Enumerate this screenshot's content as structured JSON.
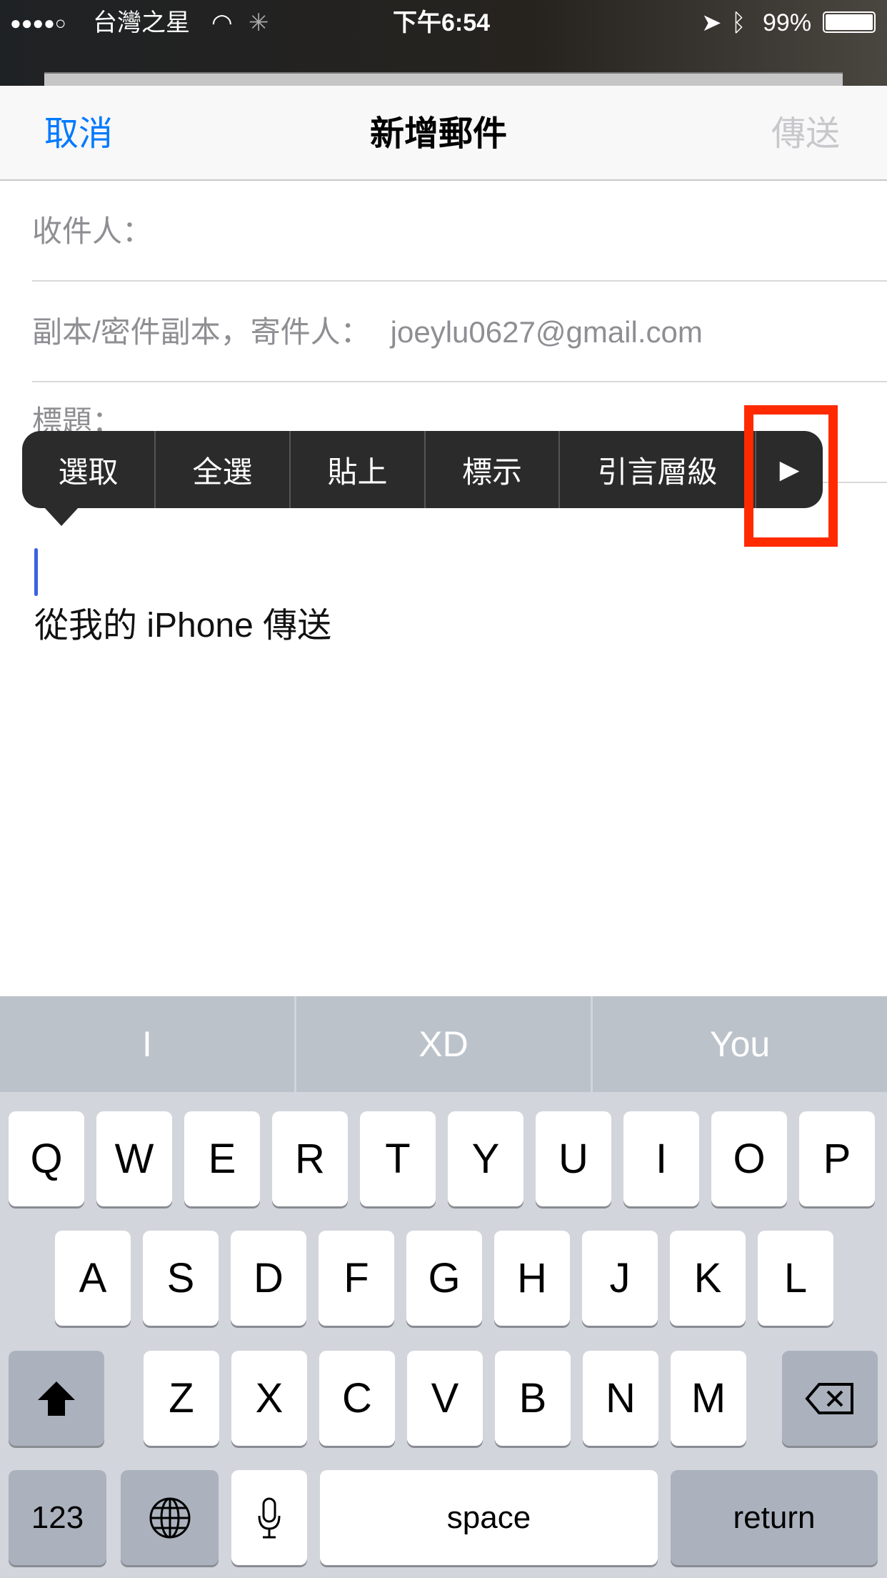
{
  "status_bar": {
    "signal": "●●●●○",
    "carrier": "台灣之星",
    "time": "下午6:54",
    "battery": "99%"
  },
  "nav": {
    "cancel": "取消",
    "title": "新增郵件",
    "send": "傳送"
  },
  "fields": {
    "to_label": "收件人：",
    "cc_label": "副本/密件副本，寄件人：",
    "cc_value": "joeylu0627@gmail.com",
    "subject_label": "標題："
  },
  "context_menu": {
    "items": [
      "選取",
      "全選",
      "貼上",
      "標示",
      "引言層級"
    ],
    "more": "▶"
  },
  "body": {
    "signature": "從我的 iPhone 傳送"
  },
  "keyboard": {
    "suggestions": [
      "I",
      "XD",
      "You"
    ],
    "row1": [
      "Q",
      "W",
      "E",
      "R",
      "T",
      "Y",
      "U",
      "I",
      "O",
      "P"
    ],
    "row2": [
      "A",
      "S",
      "D",
      "F",
      "G",
      "H",
      "J",
      "K",
      "L"
    ],
    "row3": [
      "Z",
      "X",
      "C",
      "V",
      "B",
      "N",
      "M"
    ],
    "numbers": "123",
    "space": "space",
    "return": "return"
  },
  "colors": {
    "accent": "#007aff",
    "highlight": "#ff2a00"
  }
}
